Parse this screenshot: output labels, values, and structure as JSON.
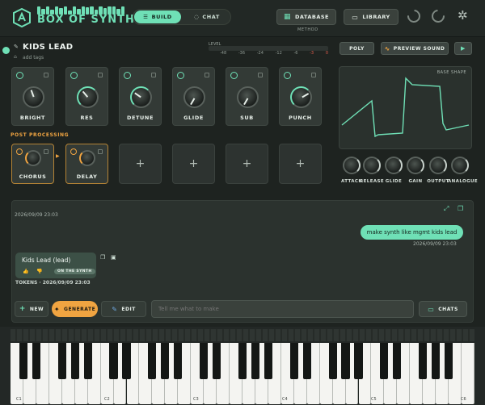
{
  "header": {
    "logo_text": "BOX OF SYNTHS",
    "modes": [
      {
        "label": "BUILD",
        "active": true
      },
      {
        "label": "CHAT",
        "active": false
      }
    ],
    "database_label": "DATABASE",
    "library_label": "LIBRARY",
    "method_label": "METHOD"
  },
  "patch": {
    "name": "KIDS LEAD",
    "tags_placeholder": "add tags",
    "level_label": "LEVEL",
    "level_ticks": [
      "-48",
      "-36",
      "-24",
      "-12",
      "-6",
      "-3",
      "0"
    ],
    "poly_label": "POLY",
    "preview_label": "PREVIEW SOUND"
  },
  "modules": [
    {
      "label": "BRIGHT"
    },
    {
      "label": "RES"
    },
    {
      "label": "DETUNE"
    },
    {
      "label": "GLIDE"
    },
    {
      "label": "SUB"
    },
    {
      "label": "PUNCH"
    }
  ],
  "post_processing": {
    "label": "POST PROCESSING",
    "effects": [
      {
        "label": "CHORUS"
      },
      {
        "label": "DELAY"
      }
    ],
    "empty_slot_glyph": "+"
  },
  "wave": {
    "label": "BASE SHAPE"
  },
  "envelope": {
    "labels": [
      "ATTACK",
      "RELEASE",
      "GLIDE",
      "GAIN",
      "OUTPUT",
      "ANALOGUE"
    ]
  },
  "chat": {
    "top_timestamp": "2026/09/09 23:03",
    "user_message": "make synth like mgmt kids lead",
    "user_timestamp": "2026/09/09 23:03",
    "bot_title": "Kids Lead (lead)",
    "bot_badge": "ON THE SYNTH",
    "tokens_line": "TOKENS · 2026/09/09 23:03",
    "new_label": "NEW",
    "generate_label": "GENERATE",
    "edit_label": "EDIT",
    "input_placeholder": "Tell me what to make",
    "chats_label": "CHATS"
  },
  "keyboard": {
    "octave_labels": [
      "C1",
      "C2",
      "C3",
      "C4",
      "C5",
      "C6"
    ]
  },
  "colors": {
    "accent": "#6fe0b6",
    "orange": "#f0a441",
    "bg": "#1e2320"
  }
}
